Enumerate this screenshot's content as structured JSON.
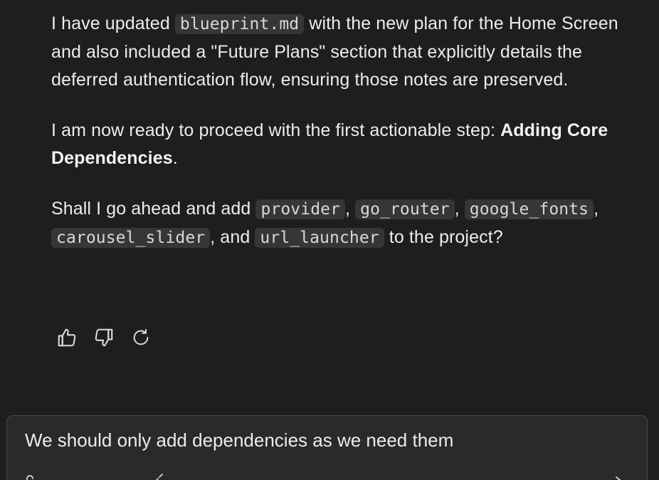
{
  "message": {
    "p1": {
      "t1": "I have updated ",
      "code1": "blueprint.md",
      "t2": " with the new plan for the Home Screen and also included a \"Future Plans\" section that explicitly details the deferred authentication flow, ensuring those notes are preserved."
    },
    "p2": {
      "t1": "I am now ready to proceed with the first actionable step: ",
      "bold": "Adding Core Dependencies",
      "t2": "."
    },
    "p3": {
      "t1": "Shall I go ahead and add ",
      "deps": [
        "provider",
        "go_router",
        "google_fonts",
        "carousel_slider",
        "url_launcher"
      ],
      "sep": ", ",
      "and": ", and ",
      "t2": " to the project?"
    }
  },
  "actions": {
    "thumbs_up_icon": "thumbs-up-icon",
    "thumbs_down_icon": "thumbs-down-icon",
    "regenerate_icon": "refresh-icon"
  },
  "composer": {
    "text": "We should only add dependencies as we need them"
  }
}
